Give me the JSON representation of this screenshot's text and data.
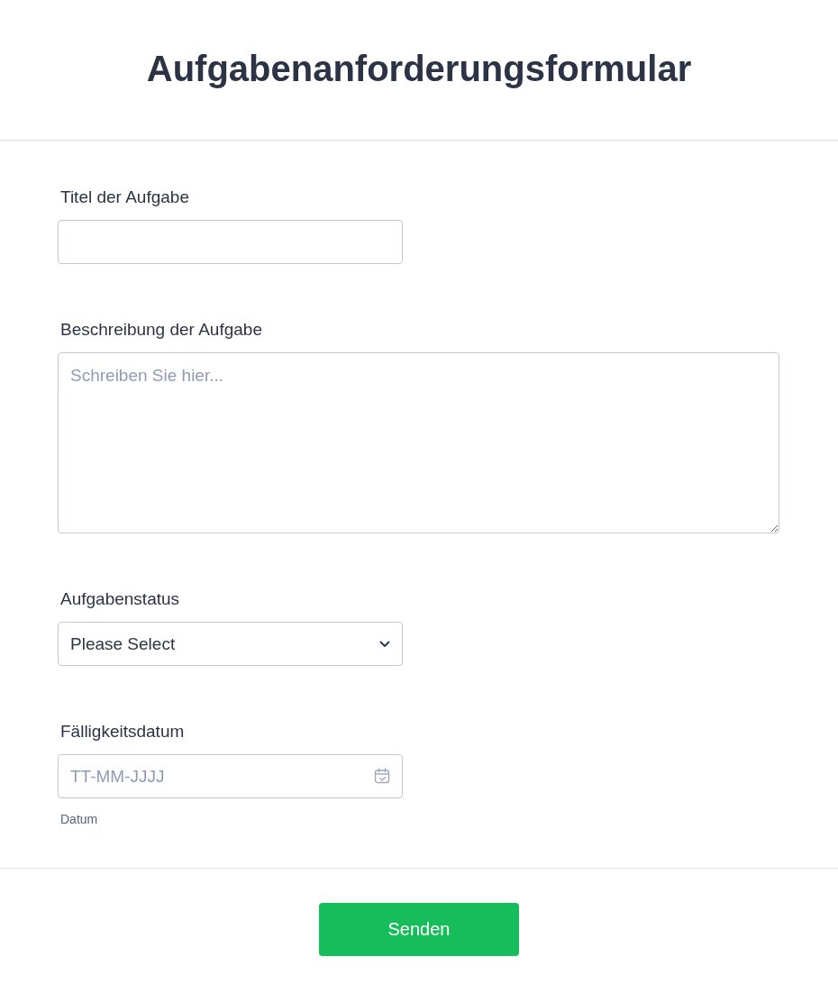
{
  "title": "Aufgabenanforderungsformular",
  "fields": [
    {
      "kind": "text",
      "label": "Titel der Aufgabe"
    },
    {
      "kind": "textarea",
      "label": "Beschreibung der Aufgabe",
      "placeholder": "Schreiben Sie hier..."
    },
    {
      "kind": "select",
      "label": "Aufgabenstatus",
      "value": "Please Select"
    },
    {
      "kind": "date",
      "label": "Fälligkeitsdatum",
      "placeholder": "TT-MM-JJJJ",
      "sublabel": "Datum"
    }
  ],
  "submit": "Senden"
}
